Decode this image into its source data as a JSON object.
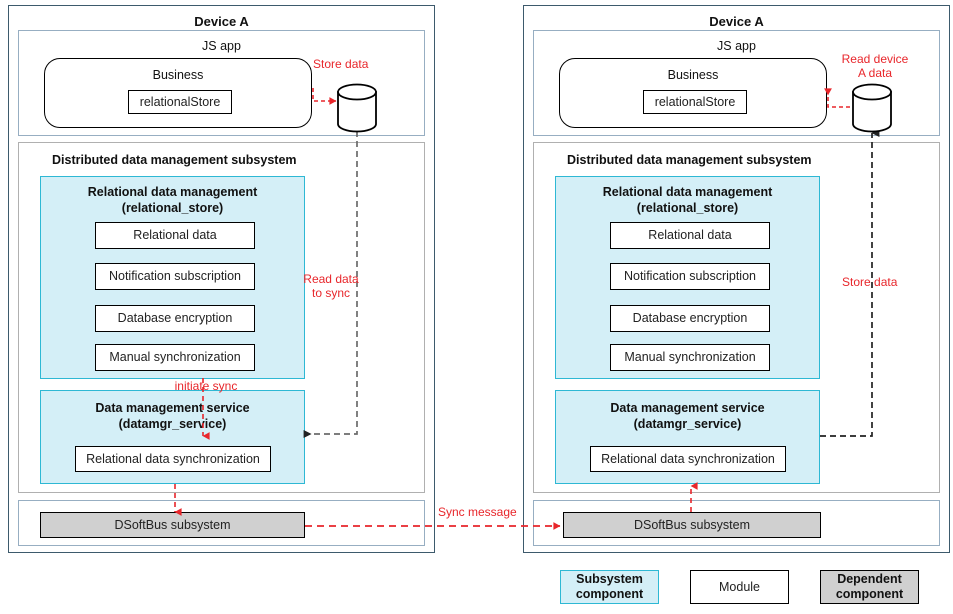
{
  "panels": [
    {
      "id": "left",
      "title": "Device A",
      "js_app": {
        "label": "JS app",
        "business": {
          "label": "Business",
          "module": "relationalStore"
        }
      },
      "ddms": {
        "label": "Distributed data management subsystem",
        "relational_store": {
          "title_line1": "Relational data management",
          "title_line2": "(relational_store)",
          "modules": [
            "Relational data",
            "Notification subscription",
            "Database encryption",
            "Manual synchronization"
          ]
        },
        "datamgr_service": {
          "title_line1": "Data management service",
          "title_line2": "(datamgr_service)",
          "modules": [
            "Relational data synchronization"
          ]
        }
      },
      "dsoftbus": "DSoftBus subsystem",
      "labels": {
        "store_data": "Store data",
        "read_data_to_sync": "Read data\nto sync",
        "initiate_sync": "initiate sync"
      }
    },
    {
      "id": "right",
      "title": "Device A",
      "js_app": {
        "label": "JS app",
        "business": {
          "label": "Business",
          "module": "relationalStore"
        }
      },
      "ddms": {
        "label": "Distributed data management subsystem",
        "relational_store": {
          "title_line1": "Relational data management",
          "title_line2": "(relational_store)",
          "modules": [
            "Relational data",
            "Notification subscription",
            "Database encryption",
            "Manual synchronization"
          ]
        },
        "datamgr_service": {
          "title_line1": "Data management service",
          "title_line2": "(datamgr_service)",
          "modules": [
            "Relational data synchronization"
          ]
        }
      },
      "dsoftbus": "DSoftBus subsystem",
      "labels": {
        "read_device_a_data": "Read device\nA data",
        "store_data": "Store data"
      }
    }
  ],
  "between": {
    "sync_message": "Sync message"
  },
  "legend": [
    {
      "key": "subsystem",
      "label": "Subsystem\ncomponent"
    },
    {
      "key": "module",
      "label": "Module"
    },
    {
      "key": "dependent",
      "label": "Dependent\ncomponent"
    }
  ],
  "colors": {
    "device_border": "#3d5a6c",
    "inner_border": "#97aec2",
    "subsystem_fill": "#d4eff7",
    "subsystem_border": "#2eb8d4",
    "dependent_fill": "#d0d0d0",
    "module_border": "#000000",
    "arrow_red": "#e8262b",
    "arrow_dark": "#333333",
    "text": "#1a1a1a"
  }
}
